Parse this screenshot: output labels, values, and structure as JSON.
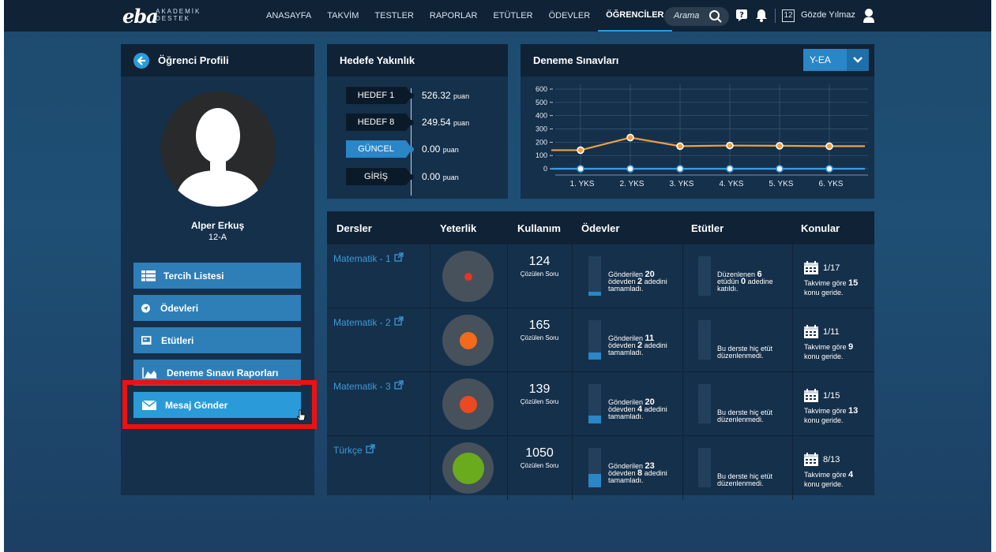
{
  "app": {
    "logo_text": "eba",
    "logo_sub_1": "AKADEMİK",
    "logo_sub_2": "DESTEK"
  },
  "nav": {
    "items": [
      "ANASAYFA",
      "TAKVİM",
      "TESTLER",
      "RAPORLAR",
      "ETÜTLER",
      "ÖDEVLER",
      "ÖĞRENCİLER"
    ],
    "active_index": 6
  },
  "search": {
    "placeholder": "Arama"
  },
  "topbar": {
    "calendar_day": "12",
    "user_name": "Gözde Yılmaz"
  },
  "profile": {
    "title": "Öğrenci Profili",
    "student_name": "Alper Erkuş",
    "student_class": "12-A",
    "menu": [
      {
        "label": "Tercih Listesi",
        "icon": "list-icon"
      },
      {
        "label": "Ödevleri",
        "icon": "paper-plane-icon"
      },
      {
        "label": "Etütleri",
        "icon": "board-icon"
      },
      {
        "label": "Deneme Sınavı Raporları",
        "icon": "area-chart-icon"
      },
      {
        "label": "Mesaj Gönder",
        "icon": "envelope-icon"
      }
    ]
  },
  "hedef": {
    "title": "Hedefe Yakınlık",
    "rows": [
      {
        "tag": "HEDEF 1",
        "value": "526.32",
        "unit": "puan"
      },
      {
        "tag": "HEDEF 8",
        "value": "249.54",
        "unit": "puan"
      },
      {
        "tag": "GÜNCEL",
        "value": "0.00",
        "unit": "puan"
      },
      {
        "tag": "GİRİŞ",
        "value": "0.00",
        "unit": "puan"
      }
    ]
  },
  "deneme": {
    "title": "Deneme Sınavları",
    "select_value": "Y-EA"
  },
  "chart_data": {
    "type": "line",
    "categories": [
      "1. YKS",
      "2. YKS",
      "3. YKS",
      "4. YKS",
      "5. YKS",
      "6. YKS"
    ],
    "yticks": [
      "600",
      "500",
      "400",
      "300",
      "200",
      "100",
      "0"
    ],
    "ylim": [
      0,
      600
    ],
    "grid": true,
    "series": [
      {
        "values": [
          140,
          235,
          170,
          175,
          173,
          170
        ],
        "color": "#f0a040"
      },
      {
        "values": [
          0,
          0,
          0,
          0,
          0,
          0
        ],
        "color": "#3a9ee0"
      }
    ]
  },
  "table": {
    "headers": [
      "Dersler",
      "Yeterlik",
      "Kullanım",
      "Ödevler",
      "Etütler",
      "Konular"
    ],
    "rows": [
      {
        "course": "Matematik - 1",
        "dot_color": "#e8351f",
        "dot_size": 10,
        "solved": "124",
        "solved_label": "Çözülen Soru",
        "odev_fill": 0.1,
        "odev_1": "Gönderilen ",
        "odev_sent": "20",
        "odev_2": "ödevden ",
        "odev_done": "2",
        "odev_3": " adedini",
        "odev_4": "tamamladı.",
        "etut_fill": 0,
        "etut_1": "Düzenlenen ",
        "etut_num": "6",
        "etut_2": "etüdün ",
        "etut_att": "0",
        "etut_3": " adedine",
        "etut_4": "katıldı.",
        "konu": "1/17",
        "konu_1": "Takvime göre ",
        "konu_behind": "15",
        "konu_2": "konu geride."
      },
      {
        "course": "Matematik - 2",
        "dot_color": "#f26a1b",
        "dot_size": 22,
        "solved": "165",
        "solved_label": "Çözülen Soru",
        "odev_fill": 0.18,
        "odev_1": "Gönderilen ",
        "odev_sent": "11",
        "odev_2": "ödevden ",
        "odev_done": "2",
        "odev_3": " adedini",
        "odev_4": "tamamladı.",
        "etut_fill": 0,
        "etut_1": "Bu derste hiç etüt",
        "etut_4": "düzenlenmedi.",
        "konu": "1/11",
        "konu_1": "Takvime göre ",
        "konu_behind": "9",
        "konu_2": "konu geride."
      },
      {
        "course": "Matematik - 3",
        "dot_color": "#ea4a1f",
        "dot_size": 22,
        "solved": "139",
        "solved_label": "Çözülen Soru",
        "odev_fill": 0.2,
        "odev_1": "Gönderilen ",
        "odev_sent": "20",
        "odev_2": "ödevden ",
        "odev_done": "4",
        "odev_3": " adedini",
        "odev_4": "tamamladı.",
        "etut_fill": 0,
        "etut_1": "Bu derste hiç etüt",
        "etut_4": "düzenlenmedi.",
        "konu": "1/15",
        "konu_1": "Takvime göre ",
        "konu_behind": "13",
        "konu_2": "konu geride."
      },
      {
        "course": "Türkçe",
        "dot_color": "#6aab1e",
        "dot_size": 40,
        "solved": "1050",
        "solved_label": "Çözülen Soru",
        "odev_fill": 0.35,
        "odev_1": "Gönderilen ",
        "odev_sent": "23",
        "odev_2": "ödevden ",
        "odev_done": "8",
        "odev_3": " adedini",
        "odev_4": "tamamladı.",
        "etut_fill": 0,
        "etut_1": "Bu derste hiç etüt",
        "etut_4": "düzenlenmedi.",
        "konu": "8/13",
        "konu_1": "Takvime göre ",
        "konu_behind": "4",
        "konu_2": "konu geride."
      }
    ]
  }
}
